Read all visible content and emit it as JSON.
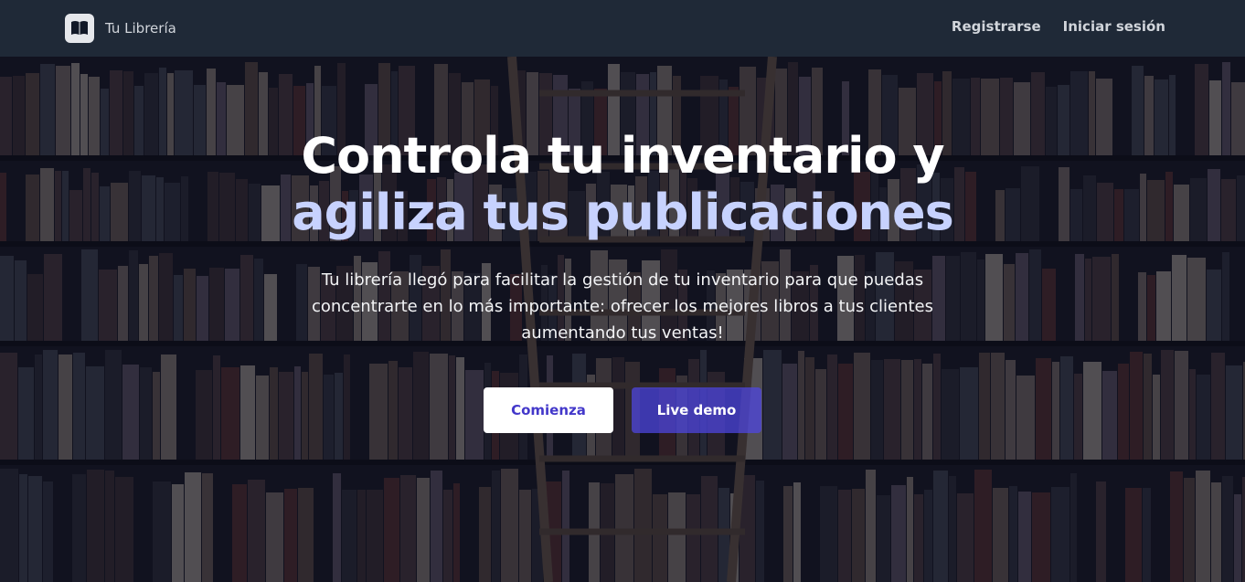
{
  "navbar": {
    "brand_name": "Tu Librería",
    "logo_icon": "book-icon",
    "links": [
      "Registrarse",
      "Iniciar sesión"
    ]
  },
  "hero": {
    "headline_line1": "Controla tu inventario y",
    "headline_line2": "agiliza tus publicaciones",
    "subtitle": "Tu librería llegó para facilitar la gestión de tu inventario para que puedas concentrarte en lo más importante: ofrecer los mejores libros a tus clientes aumentando tus ventas!",
    "primary_button": "Comienza",
    "secondary_button": "Live demo",
    "background": "bookshelf-photo"
  },
  "colors": {
    "navbar_bg": "#1f2937",
    "headline_accent": "#c7d2fe",
    "primary_button_text": "#4338ca",
    "secondary_button_bg": "#4f46e5"
  }
}
